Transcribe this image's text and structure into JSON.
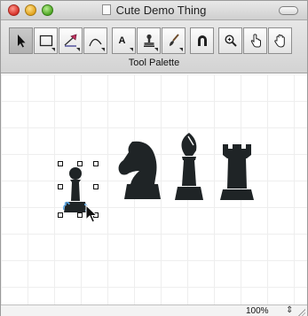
{
  "window": {
    "title": "Cute Demo Thing"
  },
  "palette": {
    "label": "Tool Palette",
    "tools": [
      {
        "name": "arrow-tool",
        "icon": "arrow-icon",
        "selected": true
      },
      {
        "name": "rectangle-tool",
        "icon": "rectangle-icon",
        "has_menu": true
      },
      {
        "name": "pen-tool",
        "icon": "pen-icon",
        "has_menu": true
      },
      {
        "name": "curve-tool",
        "icon": "curve-icon",
        "has_menu": true
      },
      {
        "name": "text-tool",
        "icon": "text-icon",
        "label": "A",
        "has_menu": true
      },
      {
        "name": "stamp-tool",
        "icon": "stamp-icon",
        "has_menu": true
      },
      {
        "name": "brush-tool",
        "icon": "brush-icon",
        "has_menu": true
      },
      {
        "name": "magnet-tool",
        "icon": "magnet-icon"
      },
      {
        "name": "zoom-tool",
        "icon": "magnifier-icon"
      },
      {
        "name": "pointer-hand-tool",
        "icon": "pointing-hand-icon"
      },
      {
        "name": "grab-hand-tool",
        "icon": "open-hand-icon"
      }
    ]
  },
  "canvas": {
    "pieces": [
      "pawn",
      "knight",
      "bishop",
      "rook"
    ],
    "selected_piece": "pawn",
    "piece_color": "#1f2426"
  },
  "statusbar": {
    "zoom": "100%"
  }
}
